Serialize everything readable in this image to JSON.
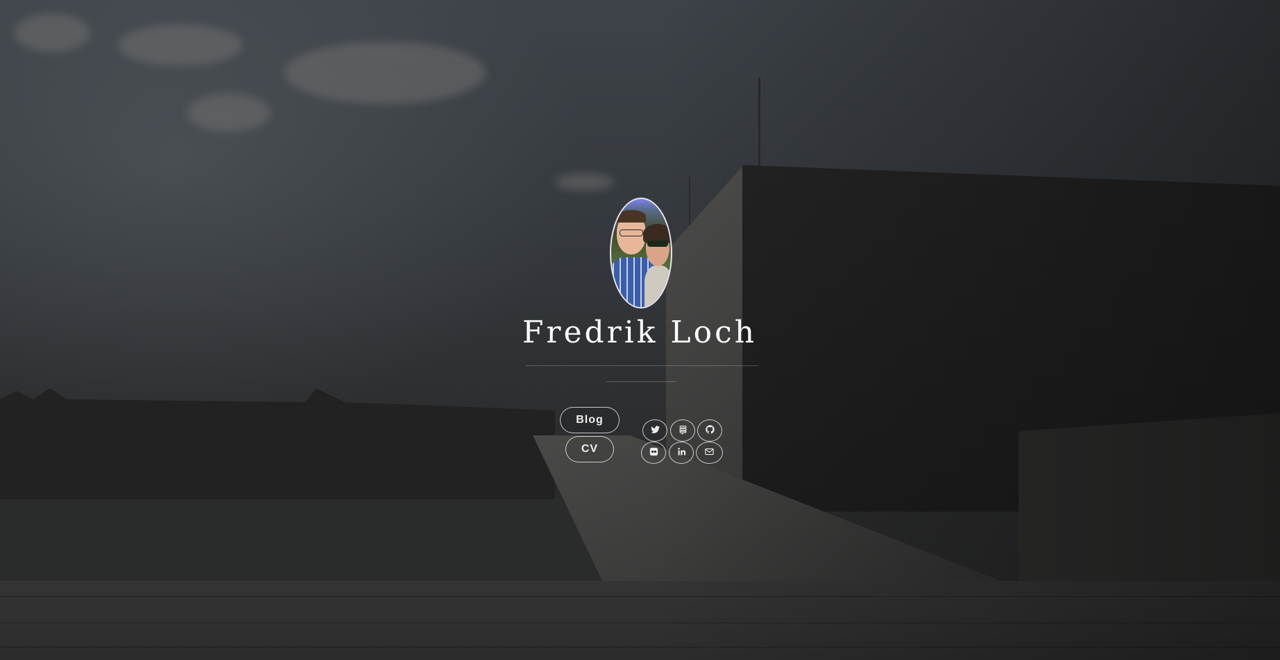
{
  "profile": {
    "name": "Fredrik Loch",
    "avatar_icon": "profile-photo"
  },
  "nav": {
    "blog_label": "Blog",
    "cv_label": "CV"
  },
  "social": [
    {
      "icon": "twitter-icon"
    },
    {
      "icon": "stackexchange-icon"
    },
    {
      "icon": "github-icon"
    },
    {
      "icon": "flickr-icon"
    },
    {
      "icon": "linkedin-icon"
    },
    {
      "icon": "email-icon"
    }
  ],
  "colors": {
    "text": "#ffffff",
    "border": "#e6e6e6",
    "overlay": "#2b2d30"
  }
}
